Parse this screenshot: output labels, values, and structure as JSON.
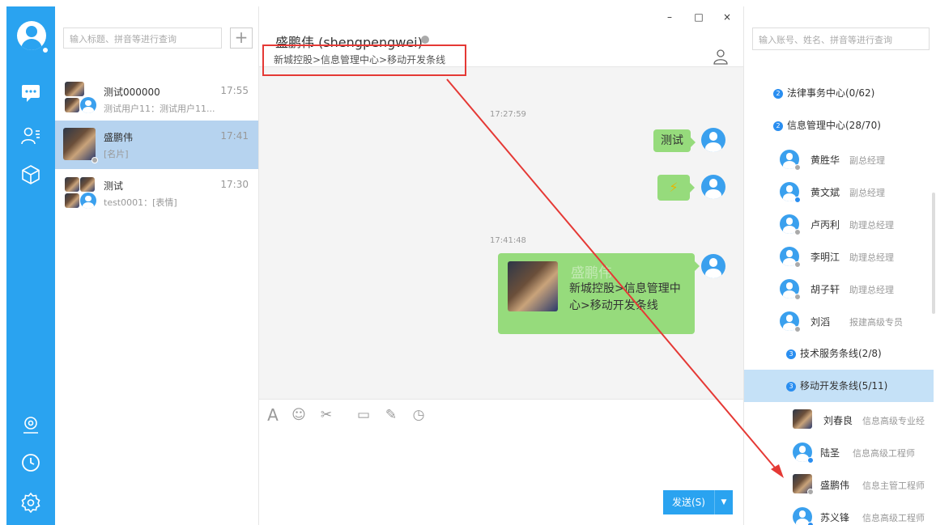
{
  "conversation_list": {
    "search_placeholder": "输入标题、拼音等进行查询",
    "add_label": "+",
    "items": [
      {
        "name": "测试000000",
        "time": "17:55",
        "preview": "测试用户11：测试用户11..."
      },
      {
        "name": "盛鹏伟",
        "time": "17:41",
        "preview": "[名片]"
      },
      {
        "name": "测试",
        "time": "17:30",
        "preview": "test0001：[表情]"
      }
    ]
  },
  "chat": {
    "window_controls": [
      "–",
      "□",
      "×"
    ],
    "title": "盛鹏伟 (shengpengwei)",
    "breadcrumb": "新城控股>信息管理中心>移动开发条线",
    "messages": [
      {
        "time": "17:27:59"
      },
      {
        "text": "测试"
      },
      {
        "emoji": "⚡"
      },
      {
        "time": "17:41:48"
      },
      {
        "card_name": "盛鹏伟",
        "card_info": "新城控股>信息管理中心>移动开发条线"
      }
    ],
    "toolbar": [
      "A",
      "☺",
      "✂",
      "▭",
      "✎",
      "◷"
    ],
    "send_label": "发送(S)",
    "send_dropdown": "▼"
  },
  "contacts": {
    "search_placeholder": "输入账号、姓名、拼音等进行查询",
    "departments": [
      {
        "badge": "2",
        "label": "法律事务中心(0/62)"
      },
      {
        "badge": "2",
        "label": "信息管理中心(28/70)"
      },
      {
        "badge": "3",
        "label": "技术服务条线(2/8)"
      },
      {
        "badge": "3",
        "label": "移动开发条线(5/11)"
      }
    ],
    "people": [
      {
        "name": "黄胜华",
        "title": "副总经理"
      },
      {
        "name": "黄文斌",
        "title": "副总经理"
      },
      {
        "name": "卢丙利",
        "title": "助理总经理"
      },
      {
        "name": "李明江",
        "title": "助理总经理"
      },
      {
        "name": "胡子轩",
        "title": "助理总经理"
      },
      {
        "name": "刘滔",
        "title": "报建高级专员"
      },
      {
        "name": "刘春良",
        "title": "信息高级专业经"
      },
      {
        "name": "陆圣",
        "title": "信息高级工程师"
      },
      {
        "name": "盛鹏伟",
        "title": "信息主管工程师"
      },
      {
        "name": "苏义锋",
        "title": "信息高级工程师"
      }
    ]
  },
  "colors": {
    "accent": "#2aa3f0",
    "bubble": "#96db7c",
    "selection": "#b6d3ef",
    "annotation": "#e53935"
  }
}
